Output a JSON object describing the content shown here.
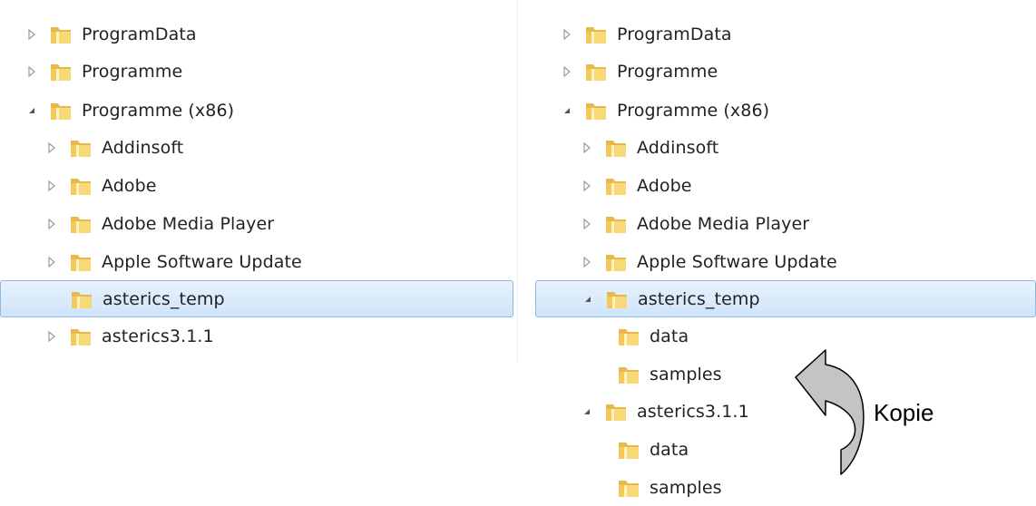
{
  "left_tree": {
    "items": [
      {
        "label": "ProgramData",
        "level": 0,
        "expander": "collapsed"
      },
      {
        "label": "Programme",
        "level": 0,
        "expander": "collapsed"
      },
      {
        "label": "Programme (x86)",
        "level": 0,
        "expander": "expanded"
      },
      {
        "label": "Addinsoft",
        "level": 1,
        "expander": "collapsed"
      },
      {
        "label": "Adobe",
        "level": 1,
        "expander": "collapsed"
      },
      {
        "label": "Adobe Media Player",
        "level": 1,
        "expander": "collapsed"
      },
      {
        "label": "Apple Software Update",
        "level": 1,
        "expander": "collapsed"
      },
      {
        "label": "asterics_temp",
        "level": 1,
        "expander": "none",
        "selected": true
      },
      {
        "label": "asterics3.1.1",
        "level": 1,
        "expander": "collapsed"
      }
    ]
  },
  "right_tree": {
    "items": [
      {
        "label": "ProgramData",
        "level": 0,
        "expander": "collapsed"
      },
      {
        "label": "Programme",
        "level": 0,
        "expander": "collapsed"
      },
      {
        "label": "Programme (x86)",
        "level": 0,
        "expander": "expanded"
      },
      {
        "label": "Addinsoft",
        "level": 1,
        "expander": "collapsed"
      },
      {
        "label": "Adobe",
        "level": 1,
        "expander": "collapsed"
      },
      {
        "label": "Adobe Media Player",
        "level": 1,
        "expander": "collapsed"
      },
      {
        "label": "Apple Software Update",
        "level": 1,
        "expander": "collapsed"
      },
      {
        "label": "asterics_temp",
        "level": 1,
        "expander": "expanded",
        "selected": true
      },
      {
        "label": "data",
        "level": 2,
        "expander": "none"
      },
      {
        "label": "samples",
        "level": 2,
        "expander": "none"
      },
      {
        "label": "asterics3.1.1",
        "level": 1,
        "expander": "expanded"
      },
      {
        "label": "data",
        "level": 2,
        "expander": "none"
      },
      {
        "label": "samples",
        "level": 2,
        "expander": "none"
      }
    ]
  },
  "annotation": {
    "text": "Kopie"
  },
  "colors": {
    "selection_fill": "#cfe4fa",
    "selection_border": "#8fb8e6",
    "folder_yellow": "#f5d06a",
    "arrow_fill": "#c0c0c0"
  }
}
